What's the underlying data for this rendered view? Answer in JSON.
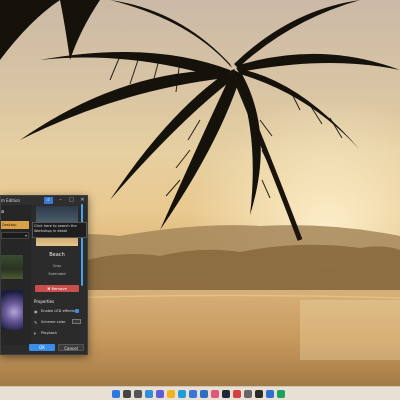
{
  "dialog": {
    "title": "m Edition",
    "left_heading": "a",
    "left_selected_label": "Desktop",
    "tooltip": "Click here to search the Workshop in detail",
    "theme_name": "Beach",
    "theme_author": "Gray",
    "theme_status": "Extended",
    "remove_label": "✖ Remove",
    "properties_heading": "Properties",
    "properties": {
      "led_label": "Enable LED effects",
      "color_label": "Scheme color",
      "playback_label": "Playback",
      "speed_min": "0.25",
      "speed_max": "1.00"
    },
    "ok_label": "OK",
    "cancel_label": "Cancel"
  },
  "taskbar": {
    "apps": [
      {
        "name": "start-icon",
        "color": "#2b78e4"
      },
      {
        "name": "search-icon",
        "color": "#444444"
      },
      {
        "name": "task-view-icon",
        "color": "#555555"
      },
      {
        "name": "widgets-icon",
        "color": "#2f8fd8"
      },
      {
        "name": "chat-icon",
        "color": "#5e5cd6"
      },
      {
        "name": "explorer-icon",
        "color": "#f0b323"
      },
      {
        "name": "edge-icon",
        "color": "#1e9fd7"
      },
      {
        "name": "store-icon",
        "color": "#3a76d9"
      },
      {
        "name": "mail-icon",
        "color": "#2e6fc4"
      },
      {
        "name": "photos-icon",
        "color": "#e0577b"
      },
      {
        "name": "steam-icon",
        "color": "#1b2838"
      },
      {
        "name": "music-icon",
        "color": "#d64040"
      },
      {
        "name": "settings-icon",
        "color": "#666666"
      },
      {
        "name": "terminal-icon",
        "color": "#2a2a2a"
      },
      {
        "name": "wallpaper-engine-icon",
        "color": "#2f6fd0"
      },
      {
        "name": "app-icon",
        "color": "#19a35b"
      }
    ]
  },
  "colors": {
    "accent": "#3a8ee6",
    "danger": "#c94f4f",
    "selection": "#d7a145"
  }
}
